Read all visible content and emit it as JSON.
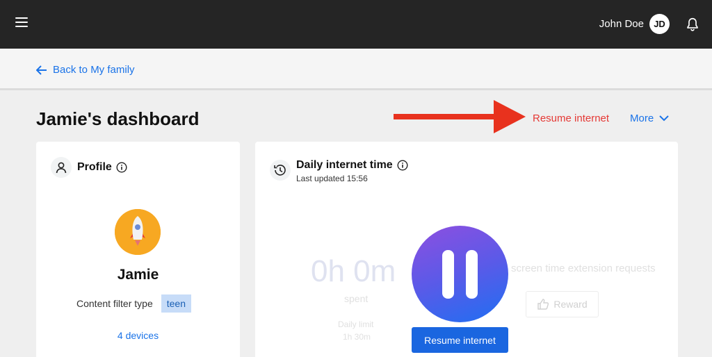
{
  "header": {
    "user_name": "John Doe",
    "user_initials": "JD"
  },
  "nav": {
    "back_label": "Back to My family"
  },
  "page": {
    "title": "Jamie's dashboard",
    "resume_label": "Resume internet",
    "more_label": "More"
  },
  "profile": {
    "title": "Profile",
    "name": "Jamie",
    "filter_label": "Content filter type",
    "filter_value": "teen",
    "devices_label": "4 devices"
  },
  "daily": {
    "title": "Daily internet time",
    "last_updated": "Last updated 15:56",
    "time_spent": "0h 0m",
    "spent_label": "spent",
    "daily_limit_label": "Daily limit",
    "daily_limit_value": "1h 30m",
    "extension_text": "screen time extension requests",
    "reward_label": "Reward",
    "resume_button": "Resume internet"
  },
  "colors": {
    "topbar": "#252525",
    "link_blue": "#1a73e8",
    "resume_red": "#e53935",
    "badge_bg": "#c7dcf8",
    "button_blue": "#1a66e0"
  },
  "icons": [
    "menu-icon",
    "bell-icon",
    "arrow-left-icon",
    "chevron-down-icon",
    "user-icon",
    "info-icon",
    "clock-icon",
    "rocket-icon",
    "thumbs-up-icon",
    "pause-icon"
  ]
}
